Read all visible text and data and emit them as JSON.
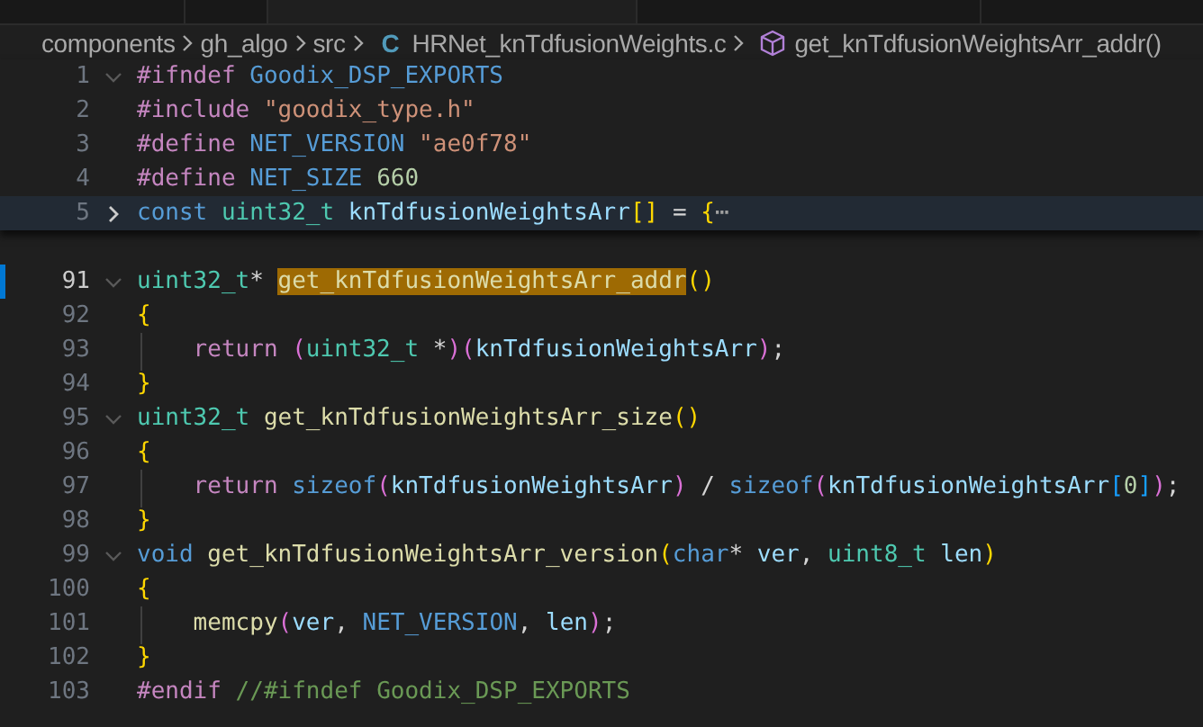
{
  "breadcrumb": [
    {
      "label": "components",
      "kind": "folder"
    },
    {
      "label": "gh_algo",
      "kind": "folder"
    },
    {
      "label": "src",
      "kind": "folder"
    },
    {
      "label": "HRNet_knTdfusionWeights.c",
      "kind": "file",
      "badge": "C"
    },
    {
      "label": "get_knTdfusionWeightsArr_addr()",
      "kind": "symbol"
    }
  ],
  "sticky_lines": [
    {
      "number": "1",
      "foldable": true,
      "collapsed": false,
      "highlighted": false,
      "current": false,
      "guide": false,
      "tokens": [
        {
          "text": "#ifndef ",
          "kind": "keyword"
        },
        {
          "text": "Goodix_DSP_EXPORTS",
          "kind": "macro"
        }
      ]
    },
    {
      "number": "2",
      "foldable": false,
      "highlighted": false,
      "current": false,
      "guide": false,
      "tokens": [
        {
          "text": "#include ",
          "kind": "keyword"
        },
        {
          "text": "\"goodix_type.h\"",
          "kind": "string"
        }
      ]
    },
    {
      "number": "3",
      "foldable": false,
      "highlighted": false,
      "current": false,
      "guide": false,
      "tokens": [
        {
          "text": "#define ",
          "kind": "keyword"
        },
        {
          "text": "NET_VERSION ",
          "kind": "macro"
        },
        {
          "text": "\"ae0f78\"",
          "kind": "string"
        }
      ]
    },
    {
      "number": "4",
      "foldable": false,
      "highlighted": false,
      "current": false,
      "guide": false,
      "tokens": [
        {
          "text": "#define ",
          "kind": "keyword"
        },
        {
          "text": "NET_SIZE ",
          "kind": "macro"
        },
        {
          "text": "660",
          "kind": "number"
        }
      ]
    },
    {
      "number": "5",
      "foldable": true,
      "collapsed": true,
      "highlighted": true,
      "current": false,
      "guide": false,
      "tokens": [
        {
          "text": "const ",
          "kind": "macro"
        },
        {
          "text": "uint32_t ",
          "kind": "type"
        },
        {
          "text": "knTdfusionWeightsArr",
          "kind": "var"
        },
        {
          "text": "[]",
          "kind": "bracket1"
        },
        {
          "text": " = ",
          "kind": "plain"
        },
        {
          "text": "{",
          "kind": "bracket1"
        },
        {
          "text": "⋯",
          "kind": "ellipsis"
        }
      ]
    }
  ],
  "lines": [
    {
      "number": "91",
      "foldable": true,
      "collapsed": false,
      "highlighted": false,
      "current": true,
      "guide": false,
      "tokens": [
        {
          "text": "uint32_t",
          "kind": "type"
        },
        {
          "text": "* ",
          "kind": "plain"
        },
        {
          "text": "get_knTdfusionWeightsArr_addr",
          "kind": "selected"
        },
        {
          "text": "()",
          "kind": "bracket1"
        }
      ]
    },
    {
      "number": "92",
      "foldable": false,
      "highlighted": false,
      "current": false,
      "guide": false,
      "tokens": [
        {
          "text": "{",
          "kind": "bracket1"
        }
      ]
    },
    {
      "number": "93",
      "foldable": false,
      "highlighted": false,
      "current": false,
      "guide": true,
      "tokens": [
        {
          "text": "    return ",
          "kind": "keyword"
        },
        {
          "text": "(",
          "kind": "bracket2"
        },
        {
          "text": "uint32_t",
          "kind": "type"
        },
        {
          "text": " *",
          "kind": "plain"
        },
        {
          "text": ")(",
          "kind": "bracket2"
        },
        {
          "text": "knTdfusionWeightsArr",
          "kind": "var"
        },
        {
          "text": ")",
          "kind": "bracket2"
        },
        {
          "text": ";",
          "kind": "plain"
        }
      ]
    },
    {
      "number": "94",
      "foldable": false,
      "highlighted": false,
      "current": false,
      "guide": false,
      "tokens": [
        {
          "text": "}",
          "kind": "bracket1"
        }
      ]
    },
    {
      "number": "95",
      "foldable": true,
      "collapsed": false,
      "highlighted": false,
      "current": false,
      "guide": false,
      "tokens": [
        {
          "text": "uint32_t ",
          "kind": "type"
        },
        {
          "text": "get_knTdfusionWeightsArr_size",
          "kind": "func"
        },
        {
          "text": "()",
          "kind": "bracket1"
        }
      ]
    },
    {
      "number": "96",
      "foldable": false,
      "highlighted": false,
      "current": false,
      "guide": false,
      "tokens": [
        {
          "text": "{",
          "kind": "bracket1"
        }
      ]
    },
    {
      "number": "97",
      "foldable": false,
      "highlighted": false,
      "current": false,
      "guide": true,
      "tokens": [
        {
          "text": "    return ",
          "kind": "keyword"
        },
        {
          "text": "sizeof",
          "kind": "macro"
        },
        {
          "text": "(",
          "kind": "bracket2"
        },
        {
          "text": "knTdfusionWeightsArr",
          "kind": "var"
        },
        {
          "text": ")",
          "kind": "bracket2"
        },
        {
          "text": " / ",
          "kind": "plain"
        },
        {
          "text": "sizeof",
          "kind": "macro"
        },
        {
          "text": "(",
          "kind": "bracket2"
        },
        {
          "text": "knTdfusionWeightsArr",
          "kind": "var"
        },
        {
          "text": "[",
          "kind": "bracket3"
        },
        {
          "text": "0",
          "kind": "number"
        },
        {
          "text": "]",
          "kind": "bracket3"
        },
        {
          "text": ")",
          "kind": "bracket2"
        },
        {
          "text": ";",
          "kind": "plain"
        }
      ]
    },
    {
      "number": "98",
      "foldable": false,
      "highlighted": false,
      "current": false,
      "guide": false,
      "tokens": [
        {
          "text": "}",
          "kind": "bracket1"
        }
      ]
    },
    {
      "number": "99",
      "foldable": true,
      "collapsed": false,
      "highlighted": false,
      "current": false,
      "guide": false,
      "tokens": [
        {
          "text": "void ",
          "kind": "macro"
        },
        {
          "text": "get_knTdfusionWeightsArr_version",
          "kind": "func"
        },
        {
          "text": "(",
          "kind": "bracket1"
        },
        {
          "text": "char",
          "kind": "macro"
        },
        {
          "text": "* ",
          "kind": "plain"
        },
        {
          "text": "ver",
          "kind": "var"
        },
        {
          "text": ", ",
          "kind": "plain"
        },
        {
          "text": "uint8_t ",
          "kind": "type"
        },
        {
          "text": "len",
          "kind": "var"
        },
        {
          "text": ")",
          "kind": "bracket1"
        }
      ]
    },
    {
      "number": "100",
      "foldable": false,
      "highlighted": false,
      "current": false,
      "guide": false,
      "tokens": [
        {
          "text": "{",
          "kind": "bracket1"
        }
      ]
    },
    {
      "number": "101",
      "foldable": false,
      "highlighted": false,
      "current": false,
      "guide": true,
      "tokens": [
        {
          "text": "    memcpy",
          "kind": "func"
        },
        {
          "text": "(",
          "kind": "bracket2"
        },
        {
          "text": "ver",
          "kind": "var"
        },
        {
          "text": ", ",
          "kind": "plain"
        },
        {
          "text": "NET_VERSION",
          "kind": "macro"
        },
        {
          "text": ", ",
          "kind": "plain"
        },
        {
          "text": "len",
          "kind": "var"
        },
        {
          "text": ")",
          "kind": "bracket2"
        },
        {
          "text": ";",
          "kind": "plain"
        }
      ]
    },
    {
      "number": "102",
      "foldable": false,
      "highlighted": false,
      "current": false,
      "guide": false,
      "tokens": [
        {
          "text": "}",
          "kind": "bracket1"
        }
      ]
    },
    {
      "number": "103",
      "foldable": false,
      "highlighted": false,
      "current": false,
      "guide": false,
      "tokens": [
        {
          "text": "#endif ",
          "kind": "keyword"
        },
        {
          "text": "//#ifndef Goodix_DSP_EXPORTS",
          "kind": "comment"
        }
      ]
    }
  ]
}
